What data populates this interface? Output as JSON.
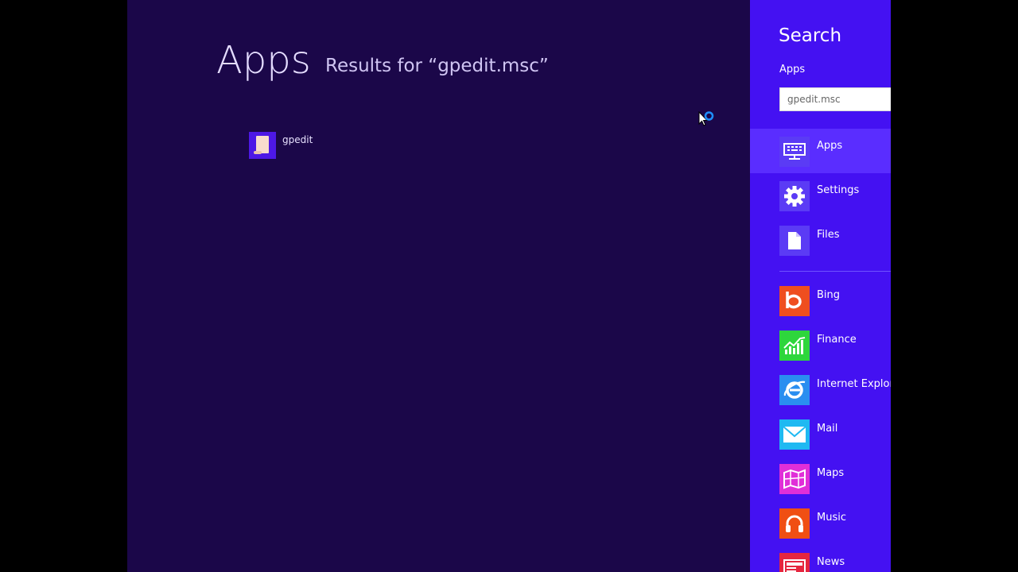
{
  "results": {
    "title": "Apps",
    "results_for": "Results for “gpedit.msc”",
    "items": [
      {
        "label": "gpedit",
        "icon": "document-scroll-icon"
      }
    ]
  },
  "charm": {
    "title": "Search",
    "scope_label": "Apps",
    "search_value": "gpedit.msc",
    "scopes": [
      {
        "label": "Apps",
        "icon": "keyboard-icon",
        "selected": true
      },
      {
        "label": "Settings",
        "icon": "gear-icon"
      },
      {
        "label": "Files",
        "icon": "file-icon"
      }
    ],
    "apps": [
      {
        "label": "Bing",
        "icon": "bing-icon",
        "color": "#ef4e1f"
      },
      {
        "label": "Finance",
        "icon": "finance-icon",
        "color": "#2ed63c"
      },
      {
        "label": "Internet Explorer",
        "icon": "ie-icon",
        "color": "#2a8ef0"
      },
      {
        "label": "Mail",
        "icon": "mail-icon",
        "color": "#1fb9f2"
      },
      {
        "label": "Maps",
        "icon": "maps-icon",
        "color": "#e02fd8"
      },
      {
        "label": "Music",
        "icon": "headphones-icon",
        "color": "#f04f13"
      },
      {
        "label": "News",
        "icon": "news-icon",
        "color": "#e5263f"
      }
    ]
  },
  "colors": {
    "start_background": "#1b0749",
    "charm_background": "#4411f2",
    "charm_selected": "#5a2dff"
  }
}
